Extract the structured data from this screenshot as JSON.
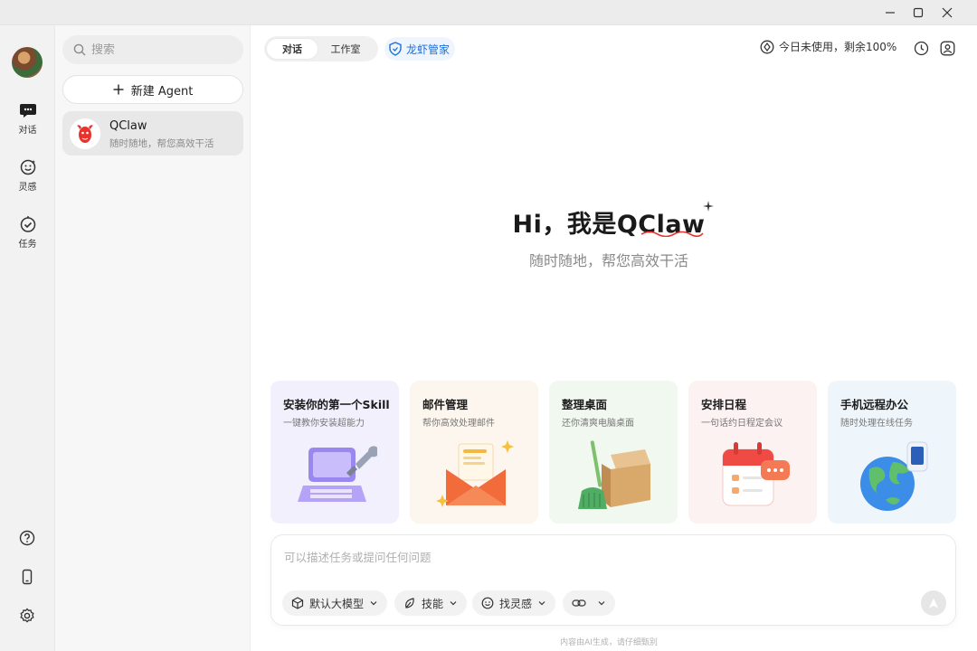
{
  "window": {
    "controls": [
      "minimize-icon",
      "maximize-icon",
      "close-icon"
    ]
  },
  "rail": {
    "items": [
      {
        "label": "对话",
        "icon": "chat-bubble-icon"
      },
      {
        "label": "灵感",
        "icon": "smile-sparkle-icon"
      },
      {
        "label": "任务",
        "icon": "check-circle-icon"
      }
    ],
    "bottom_icons": [
      "help-icon",
      "phone-icon",
      "settings-icon"
    ]
  },
  "sessions": {
    "search_placeholder": "搜索",
    "new_agent_label": "新建 Agent",
    "items": [
      {
        "name": "QClaw",
        "desc": "随时随地，帮您高效干活"
      }
    ]
  },
  "header": {
    "tabs": [
      {
        "label": "对话",
        "active": true
      },
      {
        "label": "工作室",
        "active": false
      }
    ],
    "guard_label": "龙虾管家",
    "usage_text": "今日未使用，剩余100%"
  },
  "hero": {
    "title": "Hi，我是QClaw",
    "subtitle": "随时随地，帮您高效干活"
  },
  "cards": [
    {
      "title": "安装你的第一个Skill",
      "desc": "一键教你安装超能力",
      "bg": "#f3f0fd"
    },
    {
      "title": "邮件管理",
      "desc": "帮你高效处理邮件",
      "bg": "#fdf6ee"
    },
    {
      "title": "整理桌面",
      "desc": "还你清爽电脑桌面",
      "bg": "#f1f8ef"
    },
    {
      "title": "安排日程",
      "desc": "一句话约日程定会议",
      "bg": "#fdf2f2"
    },
    {
      "title": "手机远程办公",
      "desc": "随时处理在线任务",
      "bg": "#eff6fb"
    }
  ],
  "composer": {
    "placeholder": "可以描述任务或提问任何问题",
    "chips": [
      {
        "label": "默认大模型",
        "icon": "cube-icon"
      },
      {
        "label": "技能",
        "icon": "leaf-icon"
      },
      {
        "label": "找灵感",
        "icon": "smile-icon"
      },
      {
        "label": "",
        "icon": "link-icon"
      }
    ]
  },
  "disclaimer": "内容由AI生成，请仔细甄别",
  "colors": {
    "accent": "#1d6fd8",
    "claw_red": "#e8332c"
  }
}
